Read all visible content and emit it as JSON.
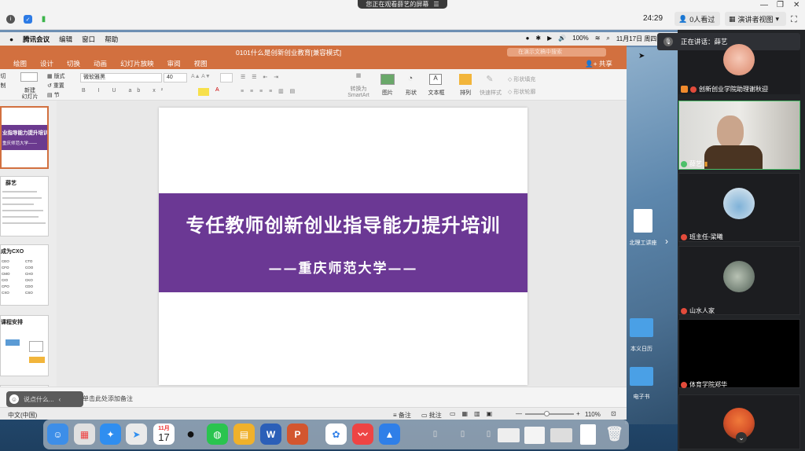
{
  "meeting": {
    "banner": "您正在观看薛艺的屏幕",
    "timer": "24:29",
    "viewers": "0人看过",
    "view_mode": "演讲者视图",
    "speaking_label": "正在讲话：薛艺"
  },
  "mac_menu": {
    "app": "腾讯会议",
    "items": [
      "编辑",
      "窗口",
      "帮助"
    ],
    "battery": "100%",
    "datetime": "11月17日 周四 下午2"
  },
  "ppt": {
    "window_title": "0101什么是创新创业教育[兼容模式]",
    "search_placeholder": "在演示文稿中搜索",
    "share": "共享",
    "tabs": [
      "绘图",
      "设计",
      "切换",
      "动画",
      "幻灯片放映",
      "审阅",
      "视图"
    ],
    "ribbon": {
      "new_slide": "新建\n幻灯片",
      "layout": "版式",
      "reset": "重置",
      "section": "节",
      "font_name": "微软雅黑",
      "font_size": "40",
      "convert_smartart": "转换为\nSmartArt",
      "picture": "图片",
      "shape": "形状",
      "textbox": "文本框",
      "arrange": "排列",
      "quick_styles": "快速样式",
      "shape_fill": "形状填充",
      "shape_outline": "形状轮廓",
      "left_label_a": "切",
      "left_label_b": "制"
    },
    "thumbnails": [
      {
        "title": "业指导能力提升培训",
        "sub": "重庆师范大学——"
      },
      {
        "title": "薛艺"
      },
      {
        "title": "成为CXO",
        "cells": [
          "CEO",
          "CTO",
          "CFO",
          "COO",
          "CMO",
          "CHO",
          "CIO",
          "CKO",
          "CPO",
          "CDO",
          "CXO",
          "CSO"
        ]
      },
      {
        "title": "课程安排"
      }
    ],
    "slide": {
      "title": "专任教师创新创业指导能力提升培训",
      "subtitle": "——重庆师范大学——"
    },
    "notes_hint": "单击此处添加备注",
    "status": {
      "language": "中文(中国)",
      "notes": "备注",
      "comments": "批注",
      "zoom": "110%"
    },
    "chat_placeholder": "说点什么..."
  },
  "desktop_icons": [
    "北理工讲座",
    "本义日历",
    "电子书"
  ],
  "dock": {
    "calendar_month": "11月",
    "calendar_day": "17"
  },
  "participants": [
    {
      "name": "创新创业学院助理谢秋迎"
    },
    {
      "name": "薛艺"
    },
    {
      "name": "班主任-梁曦"
    },
    {
      "name": "山水人家"
    },
    {
      "name": "体育学院郑华"
    }
  ],
  "colors": {
    "ppt_accent": "#d2703f",
    "slide_band": "#6b3894",
    "active_speaker": "#4cc06a"
  }
}
